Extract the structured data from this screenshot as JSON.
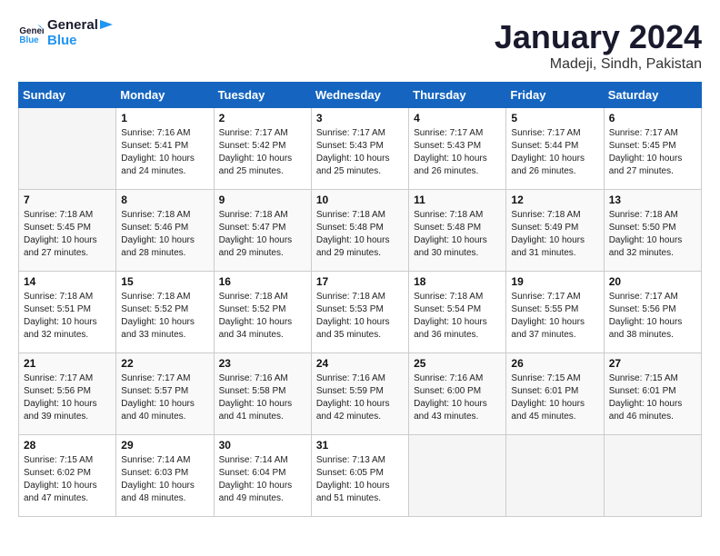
{
  "header": {
    "logo_line1": "General",
    "logo_line2": "Blue",
    "title": "January 2024",
    "subtitle": "Madeji, Sindh, Pakistan"
  },
  "calendar": {
    "days_of_week": [
      "Sunday",
      "Monday",
      "Tuesday",
      "Wednesday",
      "Thursday",
      "Friday",
      "Saturday"
    ],
    "weeks": [
      [
        {
          "day": "",
          "info": ""
        },
        {
          "day": "1",
          "info": "Sunrise: 7:16 AM\nSunset: 5:41 PM\nDaylight: 10 hours\nand 24 minutes."
        },
        {
          "day": "2",
          "info": "Sunrise: 7:17 AM\nSunset: 5:42 PM\nDaylight: 10 hours\nand 25 minutes."
        },
        {
          "day": "3",
          "info": "Sunrise: 7:17 AM\nSunset: 5:43 PM\nDaylight: 10 hours\nand 25 minutes."
        },
        {
          "day": "4",
          "info": "Sunrise: 7:17 AM\nSunset: 5:43 PM\nDaylight: 10 hours\nand 26 minutes."
        },
        {
          "day": "5",
          "info": "Sunrise: 7:17 AM\nSunset: 5:44 PM\nDaylight: 10 hours\nand 26 minutes."
        },
        {
          "day": "6",
          "info": "Sunrise: 7:17 AM\nSunset: 5:45 PM\nDaylight: 10 hours\nand 27 minutes."
        }
      ],
      [
        {
          "day": "7",
          "info": "Sunrise: 7:18 AM\nSunset: 5:45 PM\nDaylight: 10 hours\nand 27 minutes."
        },
        {
          "day": "8",
          "info": "Sunrise: 7:18 AM\nSunset: 5:46 PM\nDaylight: 10 hours\nand 28 minutes."
        },
        {
          "day": "9",
          "info": "Sunrise: 7:18 AM\nSunset: 5:47 PM\nDaylight: 10 hours\nand 29 minutes."
        },
        {
          "day": "10",
          "info": "Sunrise: 7:18 AM\nSunset: 5:48 PM\nDaylight: 10 hours\nand 29 minutes."
        },
        {
          "day": "11",
          "info": "Sunrise: 7:18 AM\nSunset: 5:48 PM\nDaylight: 10 hours\nand 30 minutes."
        },
        {
          "day": "12",
          "info": "Sunrise: 7:18 AM\nSunset: 5:49 PM\nDaylight: 10 hours\nand 31 minutes."
        },
        {
          "day": "13",
          "info": "Sunrise: 7:18 AM\nSunset: 5:50 PM\nDaylight: 10 hours\nand 32 minutes."
        }
      ],
      [
        {
          "day": "14",
          "info": "Sunrise: 7:18 AM\nSunset: 5:51 PM\nDaylight: 10 hours\nand 32 minutes."
        },
        {
          "day": "15",
          "info": "Sunrise: 7:18 AM\nSunset: 5:52 PM\nDaylight: 10 hours\nand 33 minutes."
        },
        {
          "day": "16",
          "info": "Sunrise: 7:18 AM\nSunset: 5:52 PM\nDaylight: 10 hours\nand 34 minutes."
        },
        {
          "day": "17",
          "info": "Sunrise: 7:18 AM\nSunset: 5:53 PM\nDaylight: 10 hours\nand 35 minutes."
        },
        {
          "day": "18",
          "info": "Sunrise: 7:18 AM\nSunset: 5:54 PM\nDaylight: 10 hours\nand 36 minutes."
        },
        {
          "day": "19",
          "info": "Sunrise: 7:17 AM\nSunset: 5:55 PM\nDaylight: 10 hours\nand 37 minutes."
        },
        {
          "day": "20",
          "info": "Sunrise: 7:17 AM\nSunset: 5:56 PM\nDaylight: 10 hours\nand 38 minutes."
        }
      ],
      [
        {
          "day": "21",
          "info": "Sunrise: 7:17 AM\nSunset: 5:56 PM\nDaylight: 10 hours\nand 39 minutes."
        },
        {
          "day": "22",
          "info": "Sunrise: 7:17 AM\nSunset: 5:57 PM\nDaylight: 10 hours\nand 40 minutes."
        },
        {
          "day": "23",
          "info": "Sunrise: 7:16 AM\nSunset: 5:58 PM\nDaylight: 10 hours\nand 41 minutes."
        },
        {
          "day": "24",
          "info": "Sunrise: 7:16 AM\nSunset: 5:59 PM\nDaylight: 10 hours\nand 42 minutes."
        },
        {
          "day": "25",
          "info": "Sunrise: 7:16 AM\nSunset: 6:00 PM\nDaylight: 10 hours\nand 43 minutes."
        },
        {
          "day": "26",
          "info": "Sunrise: 7:15 AM\nSunset: 6:01 PM\nDaylight: 10 hours\nand 45 minutes."
        },
        {
          "day": "27",
          "info": "Sunrise: 7:15 AM\nSunset: 6:01 PM\nDaylight: 10 hours\nand 46 minutes."
        }
      ],
      [
        {
          "day": "28",
          "info": "Sunrise: 7:15 AM\nSunset: 6:02 PM\nDaylight: 10 hours\nand 47 minutes."
        },
        {
          "day": "29",
          "info": "Sunrise: 7:14 AM\nSunset: 6:03 PM\nDaylight: 10 hours\nand 48 minutes."
        },
        {
          "day": "30",
          "info": "Sunrise: 7:14 AM\nSunset: 6:04 PM\nDaylight: 10 hours\nand 49 minutes."
        },
        {
          "day": "31",
          "info": "Sunrise: 7:13 AM\nSunset: 6:05 PM\nDaylight: 10 hours\nand 51 minutes."
        },
        {
          "day": "",
          "info": ""
        },
        {
          "day": "",
          "info": ""
        },
        {
          "day": "",
          "info": ""
        }
      ]
    ]
  }
}
